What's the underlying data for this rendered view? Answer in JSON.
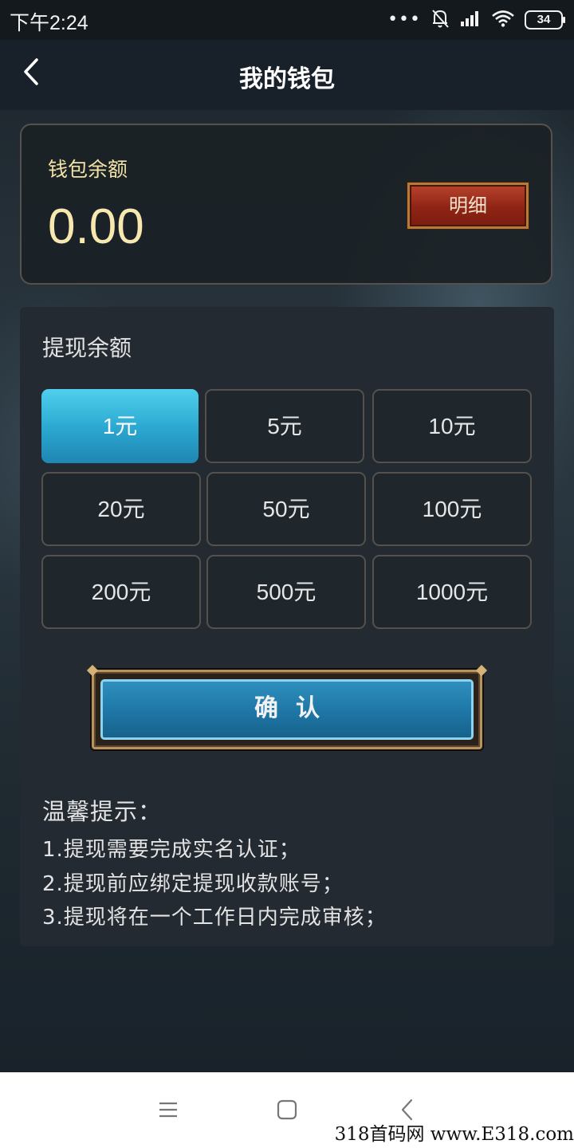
{
  "status_bar": {
    "time": "下午2:24",
    "battery": "34",
    "dots": "•••",
    "icons": [
      "mute-bell-icon",
      "signal-icon",
      "wifi-icon",
      "battery-icon"
    ]
  },
  "header": {
    "title": "我的钱包",
    "back_icon": "chevron-left-icon"
  },
  "balance": {
    "label": "钱包余额",
    "value": "0.00",
    "detail_button": "明细"
  },
  "withdraw": {
    "title": "提现余额",
    "selected_index": 0,
    "amounts": [
      "1元",
      "5元",
      "10元",
      "20元",
      "50元",
      "100元",
      "200元",
      "500元",
      "1000元"
    ],
    "confirm": "确认"
  },
  "tips": {
    "title": "温馨提示：",
    "items": [
      "1.提现需要完成实名认证；",
      "2.提现前应绑定提现收款账号；",
      "3.提现将在一个工作日内完成审核；"
    ]
  },
  "nav_bar": {
    "icons": [
      "menu-icon",
      "home-square-icon",
      "back-triangle-icon"
    ]
  },
  "watermark": "318首码网 www.E318.com",
  "colors": {
    "accent_gold": "#f7e8b0",
    "selected_blue": "#2aa6cf",
    "detail_red": "#8f2414"
  }
}
